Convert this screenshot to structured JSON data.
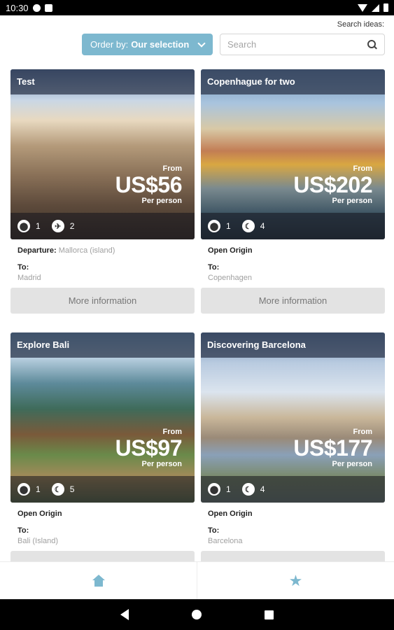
{
  "status_bar": {
    "time": "10:30"
  },
  "header": {
    "search_ideas_label": "Search ideas:",
    "order_by_prefix": "Order by:",
    "order_by_value": "Our selection",
    "search_placeholder": "Search"
  },
  "cards": [
    {
      "title": "Test",
      "from_label": "From",
      "price": "US$56",
      "per_label": "Per person",
      "stat1": "1",
      "stat2": "2",
      "line1_label": "Departure:",
      "line1_value": "Mallorca (island)",
      "to_label": "To:",
      "to_value": "Madrid",
      "button": "More information"
    },
    {
      "title": "Copenhague for two",
      "from_label": "From",
      "price": "US$202",
      "per_label": "Per person",
      "stat1": "1",
      "stat2": "4",
      "line1_label": "Open Origin",
      "line1_value": "",
      "to_label": "To:",
      "to_value": "Copenhagen",
      "button": "More information"
    },
    {
      "title": "Explore Bali",
      "from_label": "From",
      "price": "US$97",
      "per_label": "Per person",
      "stat1": "1",
      "stat2": "5",
      "line1_label": "Open Origin",
      "line1_value": "",
      "to_label": "To:",
      "to_value": "Bali (Island)",
      "button": ""
    },
    {
      "title": "Discovering Barcelona",
      "from_label": "From",
      "price": "US$177",
      "per_label": "Per person",
      "stat1": "1",
      "stat2": "4",
      "line1_label": "Open Origin",
      "line1_value": "",
      "to_label": "To:",
      "to_value": "Barcelona",
      "button": ""
    }
  ],
  "bottom_nav": {
    "home_icon": "home-icon",
    "favorites_icon": "star-icon"
  },
  "colors": {
    "accent": "#7db8cf",
    "button_gray": "#e3e3e3"
  }
}
